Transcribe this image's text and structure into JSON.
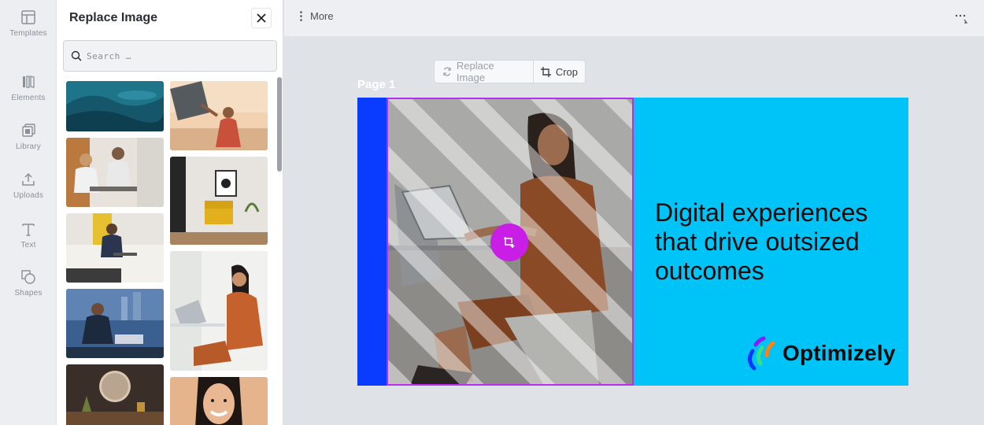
{
  "rail": {
    "items": [
      {
        "label": "Templates",
        "icon": "templates-icon"
      },
      {
        "label": "Elements",
        "icon": "elements-icon"
      },
      {
        "label": "Library",
        "icon": "library-icon"
      },
      {
        "label": "Uploads",
        "icon": "upload-icon"
      },
      {
        "label": "Text",
        "icon": "text-icon"
      },
      {
        "label": "Shapes",
        "icon": "shapes-icon"
      }
    ]
  },
  "panel": {
    "title": "Replace Image",
    "search_placeholder": "Search …"
  },
  "topbar": {
    "more_label": "More"
  },
  "image_toolbar": {
    "replace_label": "Replace Image",
    "crop_label": "Crop"
  },
  "canvas": {
    "page_label": "Page 1",
    "headline": "Digital experiences that drive outsized outcomes",
    "logo_text": "Optimizely",
    "colors": {
      "background": "#00c3f7",
      "strip": "#0a3cff",
      "selection": "#b62ff0",
      "action": "#c81ee6"
    }
  }
}
